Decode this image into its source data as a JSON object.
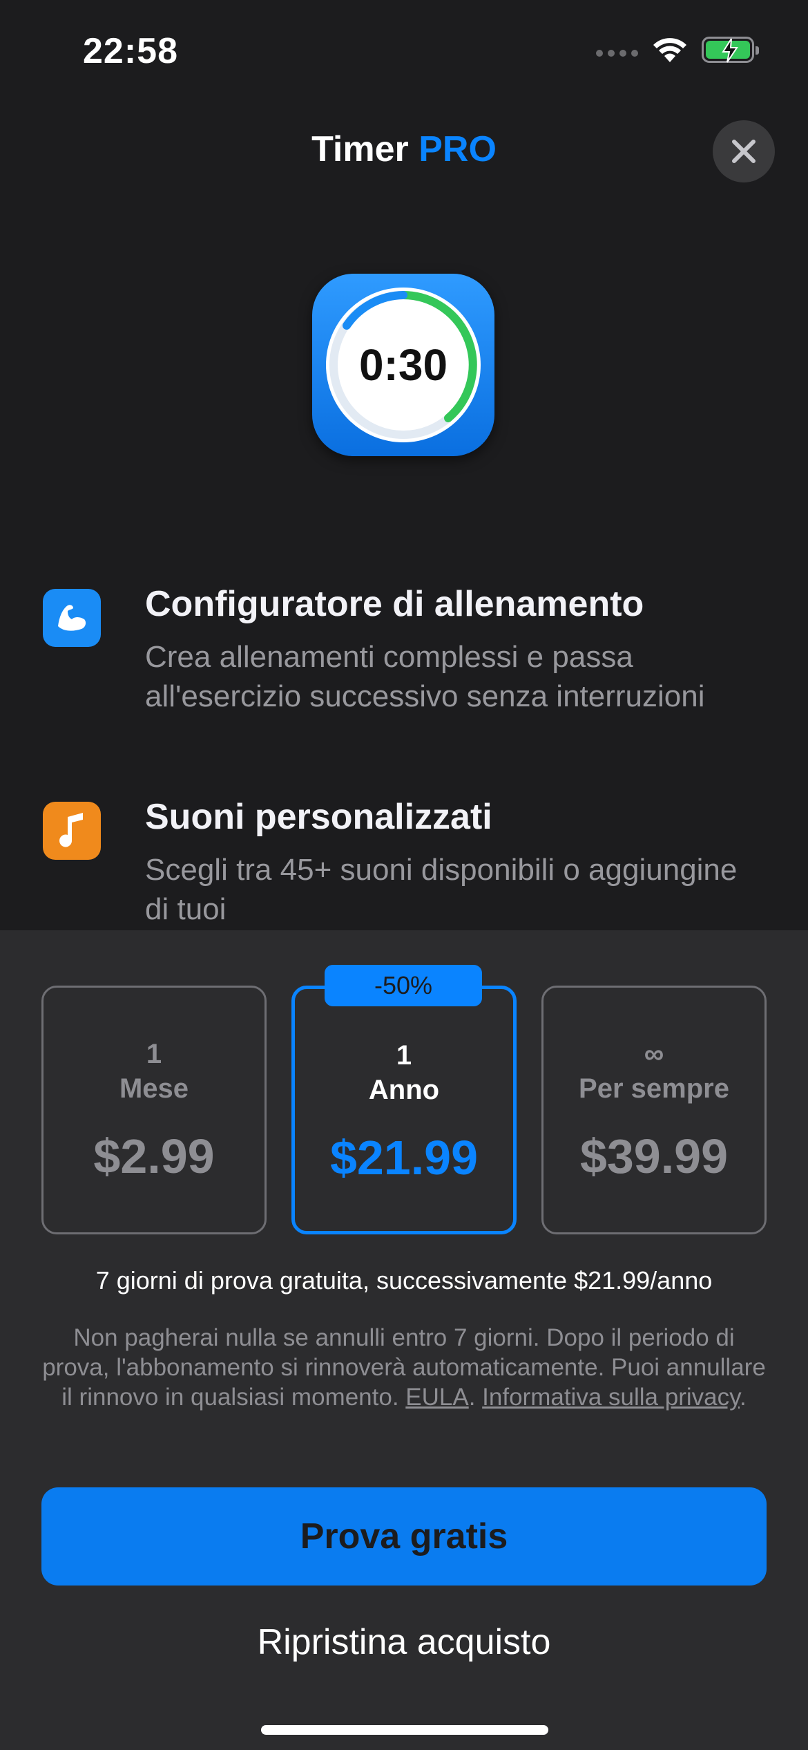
{
  "status_bar": {
    "time": "22:58"
  },
  "header": {
    "title_main": "Timer",
    "title_accent": "PRO"
  },
  "app_icon": {
    "timer_value": "0:30"
  },
  "features": [
    {
      "title": "Configuratore di allenamento",
      "description": "Crea allenamenti complessi e passa all'esercizio successivo senza interruzioni",
      "icon": "muscle-icon",
      "color": "#1a8cf5"
    },
    {
      "title": "Suoni personalizzati",
      "description": "Scegli tra 45+ suoni disponibili o aggiungine di tuoi",
      "icon": "music-note-icon",
      "color": "#f08a1c"
    }
  ],
  "plans": [
    {
      "count": "1",
      "period": "Mese",
      "price": "$2.99",
      "selected": false
    },
    {
      "count": "1",
      "period": "Anno",
      "price": "$21.99",
      "selected": true,
      "badge": "-50%"
    },
    {
      "count": "∞",
      "period": "Per sempre",
      "price": "$39.99",
      "selected": false
    }
  ],
  "trial_text": "7 giorni di prova gratuita, successivamente $21.99/anno",
  "legal": {
    "text": "Non pagherai nulla se annulli entro 7 giorni. Dopo il periodo di prova, l'abbonamento si rinnoverà automaticamente. Puoi annullare il rinnovo in qualsiasi momento. ",
    "eula": "EULA",
    "separator": ". ",
    "privacy": "Informativa sulla privacy",
    "end": "."
  },
  "cta_label": "Prova gratis",
  "restore_label": "Ripristina acquisto",
  "colors": {
    "accent": "#0a84ff",
    "background": "#1c1c1e",
    "sheet": "#2c2c2e"
  }
}
